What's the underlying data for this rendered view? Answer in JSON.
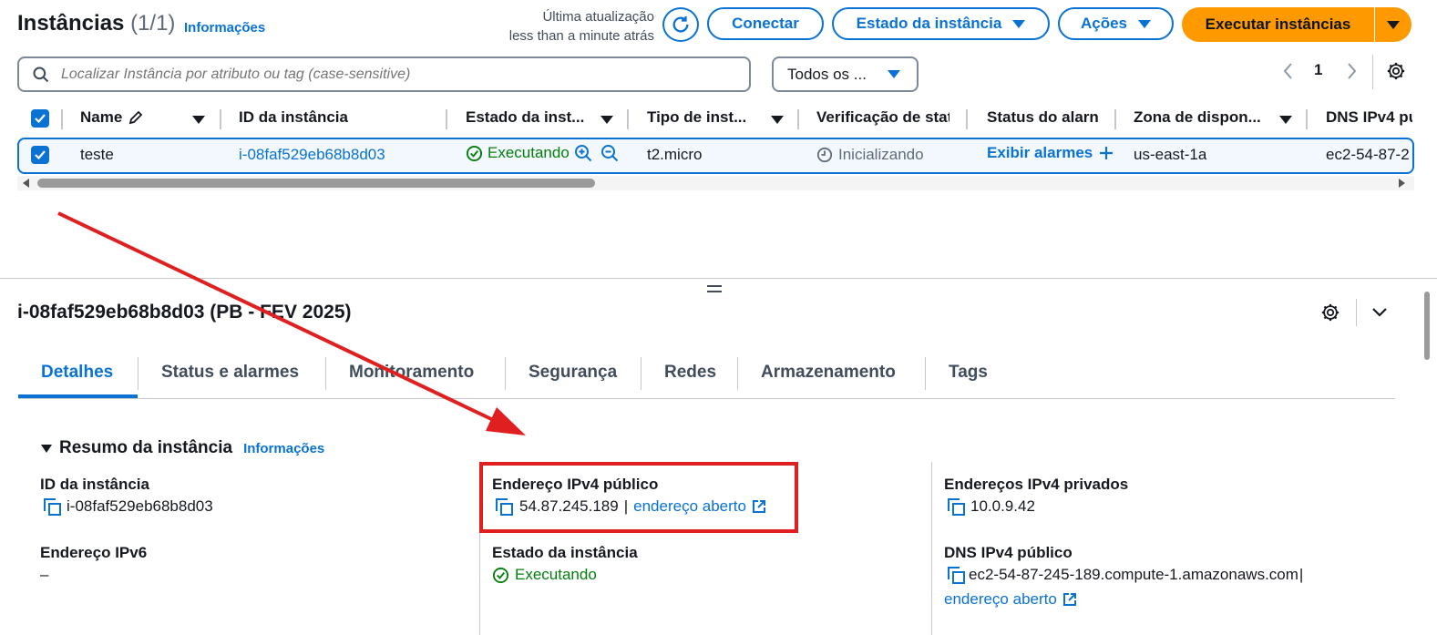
{
  "header": {
    "title": "Instâncias",
    "count": "(1/1)",
    "info_link": "Informações",
    "last_update_label": "Última atualização",
    "last_update_value": "less than a minute atrás",
    "refresh_icon": "refresh-icon",
    "connect_label": "Conectar",
    "instance_state_label": "Estado da instância",
    "actions_label": "Ações",
    "launch_label": "Executar instâncias"
  },
  "search": {
    "placeholder": "Localizar Instância por atributo ou tag (case-sensitive)",
    "filter_value": "Todos os ...",
    "page": "1"
  },
  "table": {
    "columns": [
      "Name",
      "ID da instância",
      "Estado da inst...",
      "Tipo de inst...",
      "Verificação de stat",
      "Status do alarn",
      "Zona de dispon...",
      "DNS IPv4 pú"
    ],
    "rows": [
      {
        "name": "teste",
        "id": "i-08faf529eb68b8d03",
        "state": "Executando",
        "type": "t2.micro",
        "status_check": "Inicializando",
        "alarm": "Exibir alarmes",
        "zone": "us-east-1a",
        "dns": "ec2-54-87-2"
      }
    ]
  },
  "details": {
    "title": "i-08faf529eb68b8d03 (PB - FEV 2025)",
    "tabs": [
      "Detalhes",
      "Status e alarmes",
      "Monitoramento",
      "Segurança",
      "Redes",
      "Armazenamento",
      "Tags"
    ],
    "active_tab": "Detalhes",
    "section_title": "Resumo da instância",
    "section_info": "Informações",
    "instance_id_label": "ID da instância",
    "instance_id_value": "i-08faf529eb68b8d03",
    "ipv6_label": "Endereço IPv6",
    "ipv6_value": "–",
    "public_ipv4_label": "Endereço IPv4 público",
    "public_ipv4_value": "54.87.245.189",
    "public_ipv4_sep": "|",
    "open_address": "endereço aberto",
    "state_label": "Estado da instância",
    "state_value": "Executando",
    "private_ipv4_label": "Endereços IPv4 privados",
    "private_ipv4_value": "10.0.9.42",
    "public_dns_label": "DNS IPv4 público",
    "public_dns_value": "ec2-54-87-245-189.compute-1.amazonaws.com",
    "public_dns_sep": "|",
    "public_dns_open": "endereço aberto"
  },
  "colors": {
    "primary": "#0972d3",
    "launch_button": "#ff9900",
    "success": "#037f0c",
    "annotation": "#e02020"
  }
}
